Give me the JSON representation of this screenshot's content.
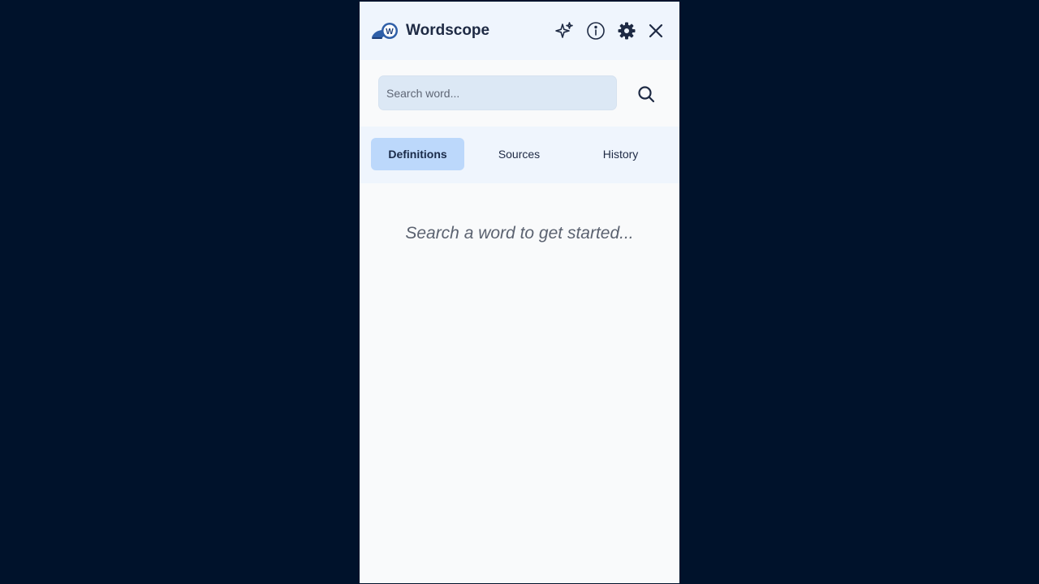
{
  "app": {
    "title": "Wordscope",
    "logo_letter": "W"
  },
  "header_icons": [
    "sparkles-icon",
    "info-icon",
    "gear-icon",
    "close-icon"
  ],
  "search": {
    "value": "",
    "placeholder": "Search word..."
  },
  "tabs": [
    {
      "label": "Definitions",
      "active": true
    },
    {
      "label": "Sources",
      "active": false
    },
    {
      "label": "History",
      "active": false
    }
  ],
  "content": {
    "empty_message": "Search a word to get started..."
  },
  "colors": {
    "background": "#00122b",
    "panel": "#f9fafb",
    "header": "#eff5fd",
    "accent": "#2f5fa8",
    "active_tab": "#bcd8fb",
    "text_dark": "#1e2a44"
  }
}
